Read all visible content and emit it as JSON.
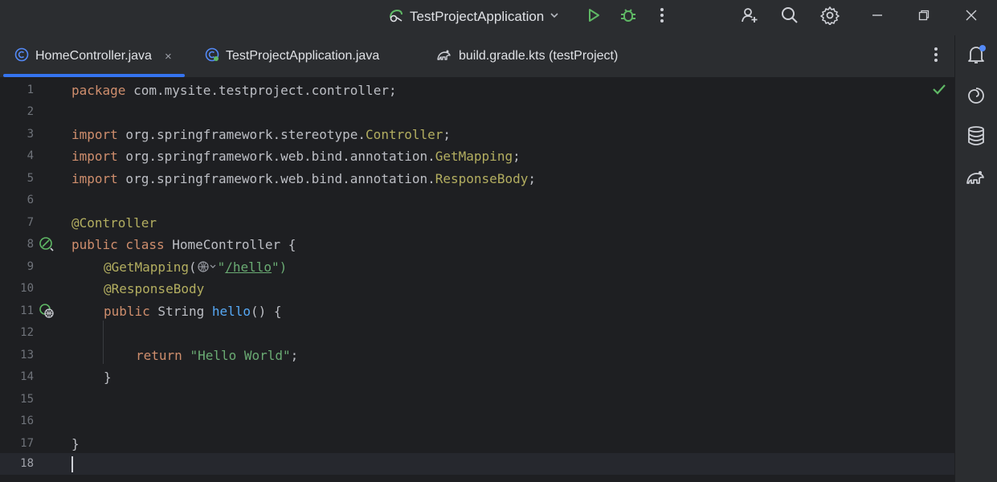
{
  "titlebar": {
    "run_config": "TestProjectApplication"
  },
  "tabs": [
    {
      "label": "HomeController.java",
      "active": true
    },
    {
      "label": "TestProjectApplication.java",
      "active": false
    },
    {
      "label": "build.gradle.kts (testProject)",
      "active": false
    }
  ],
  "tab_close": "×",
  "editor": {
    "line_numbers": [
      "1",
      "2",
      "3",
      "4",
      "5",
      "6",
      "7",
      "8",
      "9",
      "10",
      "11",
      "12",
      "13",
      "14",
      "15",
      "16",
      "17",
      "18"
    ],
    "code": {
      "l1_kw": "package",
      "l1_rest": " com.mysite.testproject.controller;",
      "import_kw": "import",
      "l3_pkg": " org.springframework.stereotype.",
      "l3_cls": "Controller",
      "l4_pkg": " org.springframework.web.bind.annotation.",
      "l4_cls": "GetMapping",
      "l5_pkg": " org.springframework.web.bind.annotation.",
      "l5_cls": "ResponseBody",
      "semicolon": ";",
      "l7_ann": "@Controller",
      "l8_kw": "public class",
      "l8_rest": " HomeController {",
      "l9_ann": "@GetMapping",
      "l9_open": "(",
      "l9_quote": "\"",
      "l9_url": "/hello",
      "l9_close": "\")",
      "l10_ann": "@ResponseBody",
      "l11_kw": "public",
      "l11_type": " String ",
      "l11_fn": "hello",
      "l11_rest": "() {",
      "l13_kw": "return",
      "l13_str": "\"Hello World\"",
      "l14": "}",
      "l17": "}"
    }
  },
  "colors": {
    "keyword": "#cf8e6d",
    "annotation": "#b3ae60",
    "string": "#6aab73",
    "function": "#56a8f5",
    "accent": "#3574f0",
    "run": "#5fb865"
  }
}
